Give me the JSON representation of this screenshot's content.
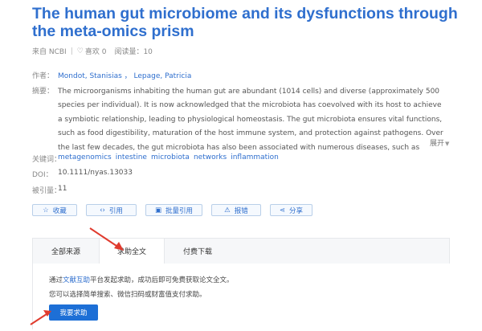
{
  "article": {
    "title": "The human gut microbiome and its dysfunctions through the meta-omics prism",
    "meta": {
      "source": "来自 NCBI",
      "likes": "喜欢 0",
      "views": "阅读量：10"
    },
    "authors_label": "作者：",
    "authors": "Mondot, Stanisias ，  Lepage, Patricia",
    "abstract_label": "摘要：",
    "abstract": "The microorganisms inhabiting the human gut are abundant (1014 cells) and diverse (approximately 500 species per individual). It is now acknowledged that the microbiota has coevolved with its host to achieve a symbiotic relationship, leading to physiological homeostasis. The gut microbiota ensures vital functions, such as food digestibility, maturation of the host immune system, and protection against pathogens. Over the last few decades, the gut microbiota has also been associated with numerous diseases, such as inflammatory bowel diseases.",
    "expand_label": "展开",
    "keywords_label": "关键词：",
    "keywords": [
      "metagenomics",
      "intestine",
      "microbiota",
      "networks",
      "inflammation"
    ],
    "doi_label": "DOI：",
    "doi": "10.1111/nyas.13033",
    "cited_label": "被引量：",
    "cited": "11"
  },
  "actions": [
    {
      "label": "收藏",
      "icon": "star-icon",
      "glyph": "☆",
      "width": 56
    },
    {
      "label": "引用",
      "icon": "code-icon",
      "glyph": "‹›",
      "width": 63
    },
    {
      "label": "批量引用",
      "icon": "batch-quote-icon",
      "glyph": "▣",
      "width": 71
    },
    {
      "label": "报错",
      "icon": "warning-icon",
      "glyph": "⚠",
      "width": 62
    },
    {
      "label": "分享",
      "icon": "share-icon",
      "glyph": "⋖",
      "width": 53
    }
  ],
  "tabs": [
    "全部来源",
    "求助全文",
    "付费下载"
  ],
  "help": {
    "line1_prefix": "通过",
    "line1_link": "文献互助",
    "line1_suffix": "平台发起求助，成功后即可免费获取论文全文。",
    "line2": "您可以选择简单搜索、微信扫码或财富值支付求助。",
    "button": "我要求助"
  }
}
